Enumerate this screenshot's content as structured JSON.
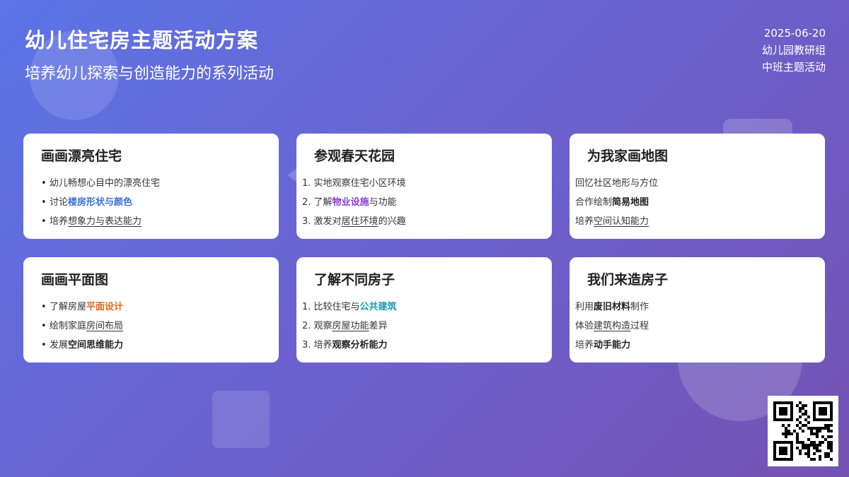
{
  "header": {
    "title": "幼儿住宅房主题活动方案",
    "subtitle": "培养幼儿探索与创造能力的系列活动",
    "date": "2025-06-20",
    "org": "幼儿园教研组",
    "category": "中班主题活动"
  },
  "cards": [
    {
      "title": "画画漂亮住宅",
      "items": [
        {
          "a": "幼儿畅想心目中的漂亮住宅",
          "b": "",
          "c": ""
        },
        {
          "a": "讨论",
          "b": "楼房形状与颜色",
          "c": ""
        },
        {
          "a": "培养",
          "b": "想象力与表达能力",
          "c": ""
        }
      ]
    },
    {
      "title": "参观春天花园",
      "items": [
        {
          "a": "1. 实地观察住宅小区环境",
          "b": "",
          "c": ""
        },
        {
          "a": "2. 了解",
          "b": "物业设施",
          "c": "与功能"
        },
        {
          "a": "3. 激发对",
          "b": "居住环境",
          "c": "的兴趣"
        }
      ]
    },
    {
      "title": "为我家画地图",
      "items": [
        {
          "a": "回忆社区地形与方位",
          "b": "",
          "c": ""
        },
        {
          "a": "合作绘制",
          "b": "简易地图",
          "c": ""
        },
        {
          "a": "培养",
          "b": "空间认知能力",
          "c": ""
        }
      ]
    },
    {
      "title": "画画平面图",
      "items": [
        {
          "a": "了解房屋",
          "b": "平面设计",
          "c": ""
        },
        {
          "a": "绘制家庭",
          "b": "房间布局",
          "c": ""
        },
        {
          "a": "发展",
          "b": "空间思维能力",
          "c": ""
        }
      ]
    },
    {
      "title": "了解不同房子",
      "items": [
        {
          "a": "1. 比较住宅与",
          "b": "公共建筑",
          "c": ""
        },
        {
          "a": "2. 观察",
          "b": "房屋功能",
          "c": "差异"
        },
        {
          "a": "3. 培养",
          "b": "观察分析能力",
          "c": ""
        }
      ]
    },
    {
      "title": "我们来造房子",
      "items": [
        {
          "a": "利用",
          "b": "废旧材料",
          "c": "制作"
        },
        {
          "a": "体验",
          "b": "建筑构造",
          "c": "过程"
        },
        {
          "a": "培养",
          "b": "动手能力",
          "c": ""
        }
      ]
    }
  ],
  "qr_icon": "qr-code-icon"
}
